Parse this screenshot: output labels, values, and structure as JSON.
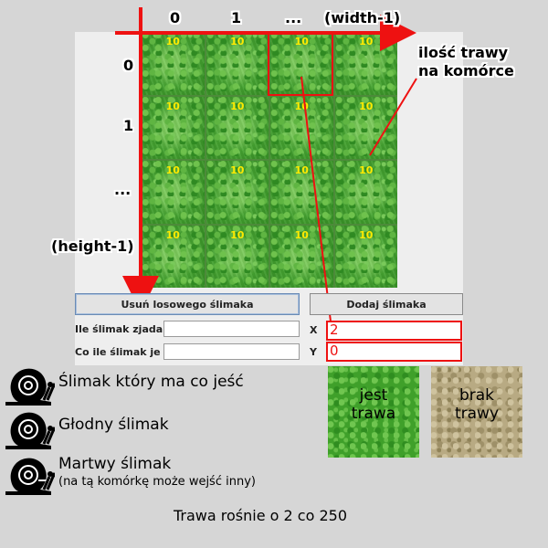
{
  "colors": {
    "annotation": "#ee1111",
    "grass_value": "#ffea00"
  },
  "axis": {
    "col_labels": [
      "0",
      "1",
      "...",
      "(width-1)"
    ],
    "row_labels": [
      "0",
      "1",
      "...",
      "(height-1)"
    ]
  },
  "grid": {
    "values": [
      [
        "10",
        "10",
        "10",
        "10"
      ],
      [
        "10",
        "10",
        "10",
        "10"
      ],
      [
        "10",
        "10",
        "10",
        "10"
      ],
      [
        "10",
        "10",
        "10",
        "10"
      ]
    ]
  },
  "annotations": {
    "cell_grass": "ilość trawy\nna komórce"
  },
  "buttons": {
    "remove_random": "Usuń losowego ślimaka",
    "add": "Dodaj ślimaka"
  },
  "form": {
    "eats_label": "Ile ślimak zjada",
    "eats_value": "",
    "is_label": "Co ile ślimak je",
    "is_value": "",
    "x_label": "X",
    "x_value": "2",
    "y_label": "Y",
    "y_value": "0"
  },
  "legend": {
    "fed": "Ślimak który ma co jeść",
    "hungry": "Głodny ślimak",
    "dead": "Martwy ślimak",
    "dead_note": "(na tą komórkę może wejść inny)"
  },
  "swatches": {
    "grass": "jest\ntrawa",
    "no_grass": "brak\ntrawy"
  },
  "footer": "Trawa rośnie o 2 co 250",
  "icons": [
    "snail-icon",
    "hungry-snail-icon",
    "dead-snail-icon"
  ]
}
